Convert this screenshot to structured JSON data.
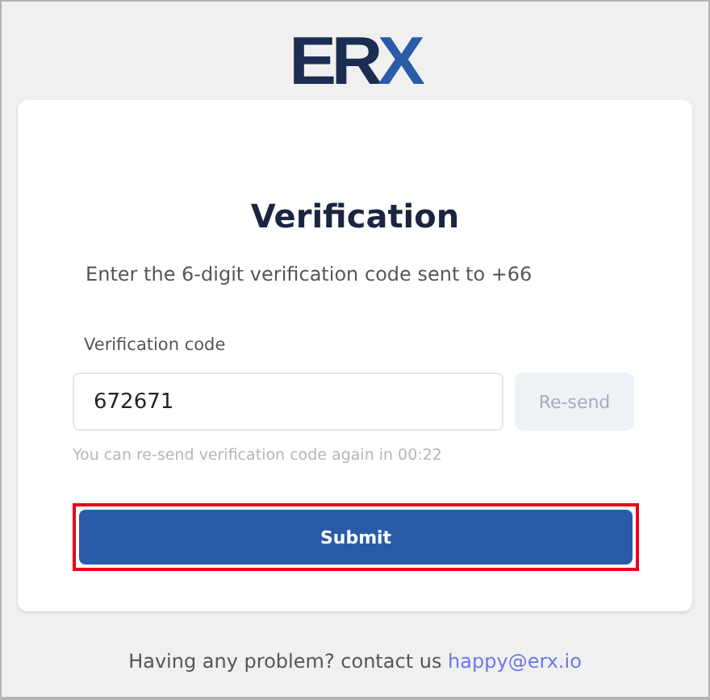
{
  "logo": {
    "dark": "ER",
    "accent": "X"
  },
  "title": "Verification",
  "subtitle": "Enter the 6-digit verification code sent to +66",
  "code_field": {
    "label": "Verification code",
    "value": "672671"
  },
  "resend_button": {
    "label": "Re-send",
    "disabled": true
  },
  "hint": "You can re-send verification code again in 00:22",
  "submit_button": {
    "label": "Submit",
    "highlighted": true
  },
  "footer": {
    "text": "Having any problem? contact us",
    "link": "happy@erx.io"
  }
}
